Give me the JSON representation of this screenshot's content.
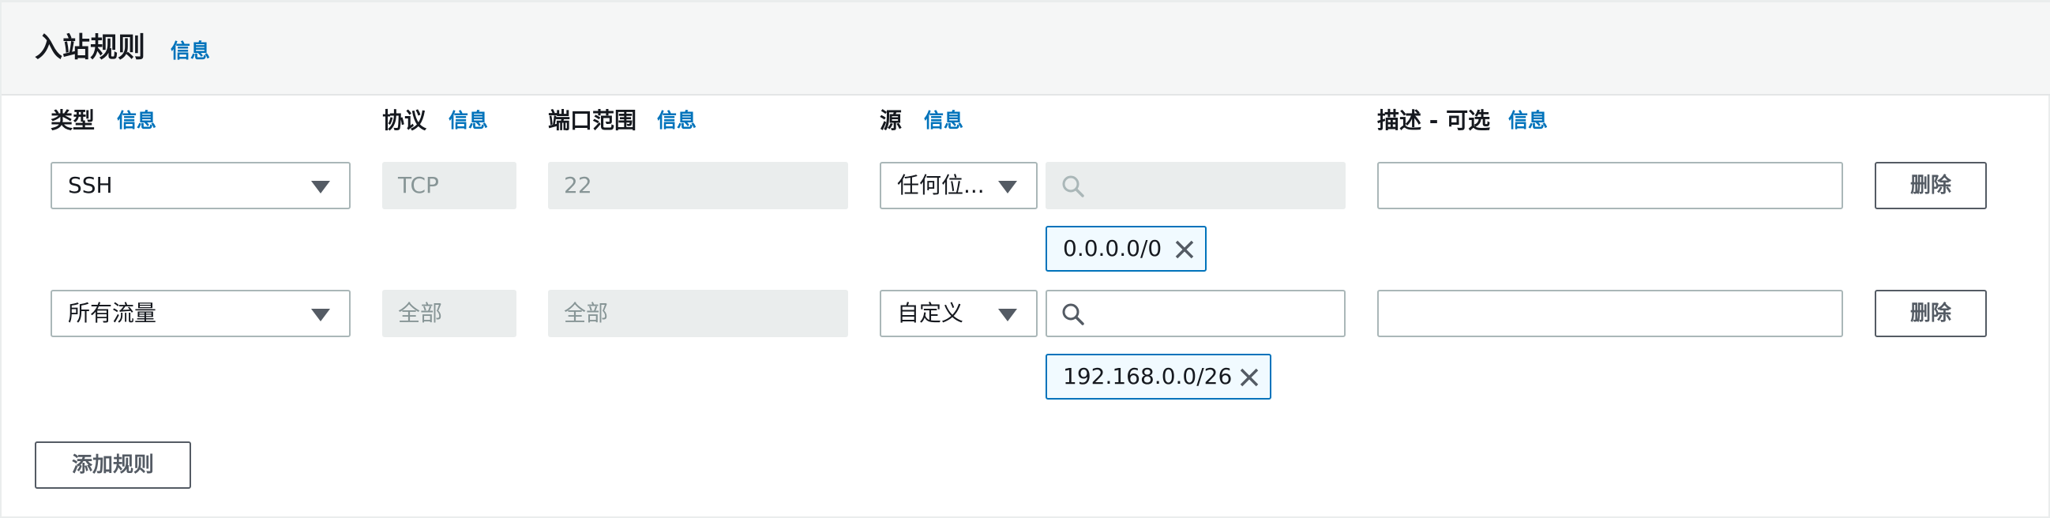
{
  "header": {
    "title": "入站规则",
    "info": "信息"
  },
  "columns": {
    "type": {
      "label": "类型",
      "info": "信息"
    },
    "protocol": {
      "label": "协议",
      "info": "信息"
    },
    "port_range": {
      "label": "端口范围",
      "info": "信息"
    },
    "source": {
      "label": "源",
      "info": "信息"
    },
    "description": {
      "label": "描述 - 可选",
      "info": "信息"
    }
  },
  "rules": [
    {
      "type": "SSH",
      "protocol": "TCP",
      "port_range": "22",
      "source_type": "任何位...",
      "search_value": "",
      "cidr_token": "0.0.0.0/0",
      "description": "",
      "delete_label": "删除",
      "search_enabled": false
    },
    {
      "type": "所有流量",
      "protocol": "全部",
      "port_range": "全部",
      "source_type": "自定义",
      "search_value": "",
      "cidr_token": "192.168.0.0/26",
      "description": "",
      "delete_label": "删除",
      "search_enabled": true
    }
  ],
  "add_rule_label": "添加规则",
  "icons": {
    "dropdown": "caret-down-icon",
    "search": "search-icon",
    "remove": "close-icon"
  },
  "colors": {
    "link": "#0073bb",
    "border": "#aab7b8",
    "disabled_bg": "#eaeded",
    "token_border": "#0073bb",
    "token_bg": "#f1faff"
  }
}
